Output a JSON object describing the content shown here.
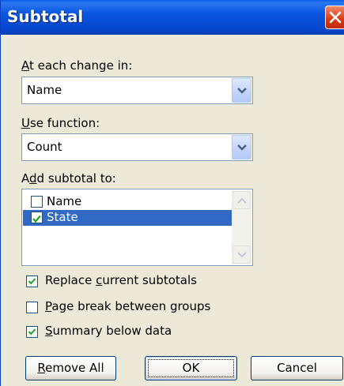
{
  "dialog": {
    "title": "Subtotal",
    "close_icon": "close-icon"
  },
  "at_each_change": {
    "label_underlined": "A",
    "label_rest": "t each change in:",
    "value": "Name"
  },
  "use_function": {
    "label_underlined": "U",
    "label_rest": "se function:",
    "value": "Count"
  },
  "add_subtotal": {
    "label_pre": "A",
    "label_underlined": "d",
    "label_rest": "d subtotal to:",
    "items": [
      {
        "label": "Name",
        "checked": false,
        "selected": false
      },
      {
        "label": "State",
        "checked": true,
        "selected": true
      }
    ]
  },
  "options": {
    "replace": {
      "pre": "Replace ",
      "underlined": "c",
      "rest": "urrent subtotals",
      "checked": true
    },
    "page_break": {
      "pre": "",
      "underlined": "P",
      "rest": "age break between groups",
      "checked": false
    },
    "summary": {
      "pre": "",
      "underlined": "S",
      "rest": "ummary below data",
      "checked": true
    }
  },
  "buttons": {
    "remove_all": {
      "underlined": "R",
      "rest": "emove All"
    },
    "ok": "OK",
    "cancel": "Cancel"
  },
  "colors": {
    "title_bar": "#0a55e0",
    "dialog_bg": "#ece9d8",
    "selection": "#316ac5",
    "check": "#21a121"
  }
}
